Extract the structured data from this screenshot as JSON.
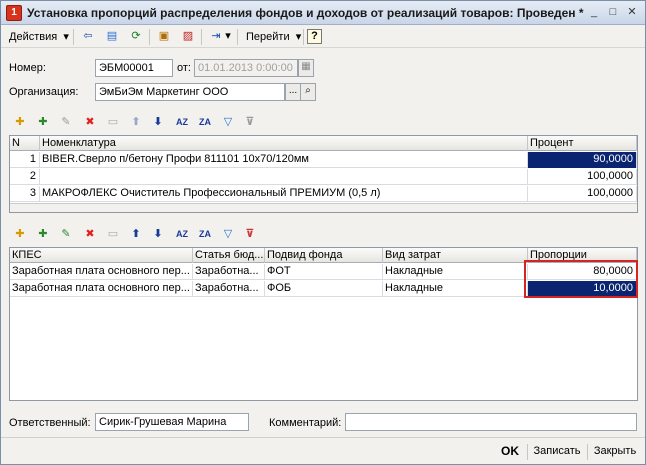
{
  "window": {
    "title": "Установка пропорций распределения фондов и доходов от реализаций товаров: Проведен *",
    "controls": {
      "minimize": "_",
      "maximize": "□",
      "close": "✕"
    }
  },
  "toolbar": {
    "actions_label": "Действия",
    "goto_label": "Перейти",
    "help_label": "?",
    "icons": [
      "back-icon",
      "document-icon",
      "refresh-icon",
      "post-document-icon",
      "unpost-document-icon",
      "open-form-icon",
      "help-icon"
    ]
  },
  "header": {
    "number_label": "Номер:",
    "number_value": "ЭБМ00001",
    "date_label": "от:",
    "date_value": "01.01.2013  0:00:00",
    "org_label": "Организация:",
    "org_value": "ЭмБиЭм Маркетинг ООО",
    "select_btn": "...",
    "open_btn": "🔍"
  },
  "grid1": {
    "headers": {
      "n": "N",
      "nomenclature": "Номенклатура",
      "percent": "Процент"
    },
    "rows": [
      {
        "n": "1",
        "nomenclature": "BIBER.Сверло п/бетону Профи 811101 10х70/120мм",
        "percent": "90,0000",
        "selected": true
      },
      {
        "n": "2",
        "nomenclature": "",
        "percent": "100,0000",
        "selected": false
      },
      {
        "n": "3",
        "nomenclature": "МАКРОФЛЕКС Очиститель Профессиональный ПРЕМИУМ (0,5 л)",
        "percent": "100,0000",
        "selected": false
      }
    ]
  },
  "grid2": {
    "headers": {
      "kpes": "КПЕС",
      "budget": "Статья бюд...",
      "fund": "Подвид фонда",
      "cost": "Вид затрат",
      "prop": "Пропорции"
    },
    "rows": [
      {
        "kpes": "Заработная плата основного пер...",
        "budget": "Заработна...",
        "fund": "ФОТ",
        "cost": "Накладные",
        "prop": "80,0000",
        "selected": false
      },
      {
        "kpes": "Заработная плата основного пер...",
        "budget": "Заработна...",
        "fund": "ФОБ",
        "cost": "Накладные",
        "prop": "10,0000",
        "selected": true
      }
    ]
  },
  "footer": {
    "responsible_label": "Ответственный:",
    "responsible_value": "Сирик-Грушевая Марина",
    "comment_label": "Комментарий:",
    "comment_value": "",
    "ok_label": "OK",
    "save_label": "Записать",
    "close_label": "Закрыть"
  },
  "colors": {
    "selection": "#0a2472",
    "highlight": "#d42424"
  }
}
